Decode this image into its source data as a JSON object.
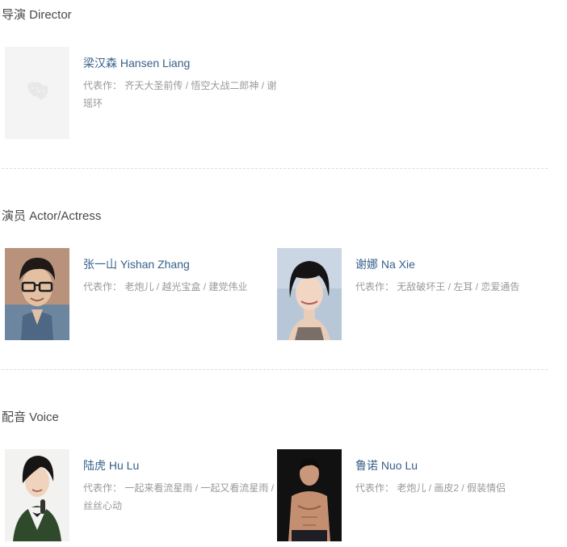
{
  "sections": [
    {
      "title": "导演 Director",
      "people": [
        {
          "name": "梁汉森 Hansen Liang",
          "works_label": "代表作：",
          "works": [
            "齐天大圣前传",
            "悟空大战二郎神",
            "谢瑶环"
          ],
          "has_photo": false
        }
      ]
    },
    {
      "title": "演员 Actor/Actress",
      "people": [
        {
          "name": "张一山 Yishan Zhang",
          "works_label": "代表作：",
          "works": [
            "老炮儿",
            "越光宝盒",
            "建党伟业"
          ],
          "has_photo": true
        },
        {
          "name": "谢娜 Na Xie",
          "works_label": "代表作：",
          "works": [
            "无敌破坏王",
            "左耳",
            "恋爱通告"
          ],
          "has_photo": true
        }
      ]
    },
    {
      "title": "配音 Voice",
      "people": [
        {
          "name": "陆虎 Hu Lu",
          "works_label": "代表作：",
          "works": [
            "一起来看流星雨",
            "一起又看流星雨",
            "丝丝心动"
          ],
          "has_photo": true
        },
        {
          "name": "鲁诺 Nuo Lu",
          "works_label": "代表作：",
          "works": [
            "老炮儿",
            "画皮2",
            "假装情侣"
          ],
          "has_photo": true
        }
      ]
    }
  ],
  "works_separator": " / ",
  "colors": {
    "name_link": "#37608a",
    "works_text": "#999999",
    "title_text": "#494949",
    "divider": "#dcdcdc"
  }
}
